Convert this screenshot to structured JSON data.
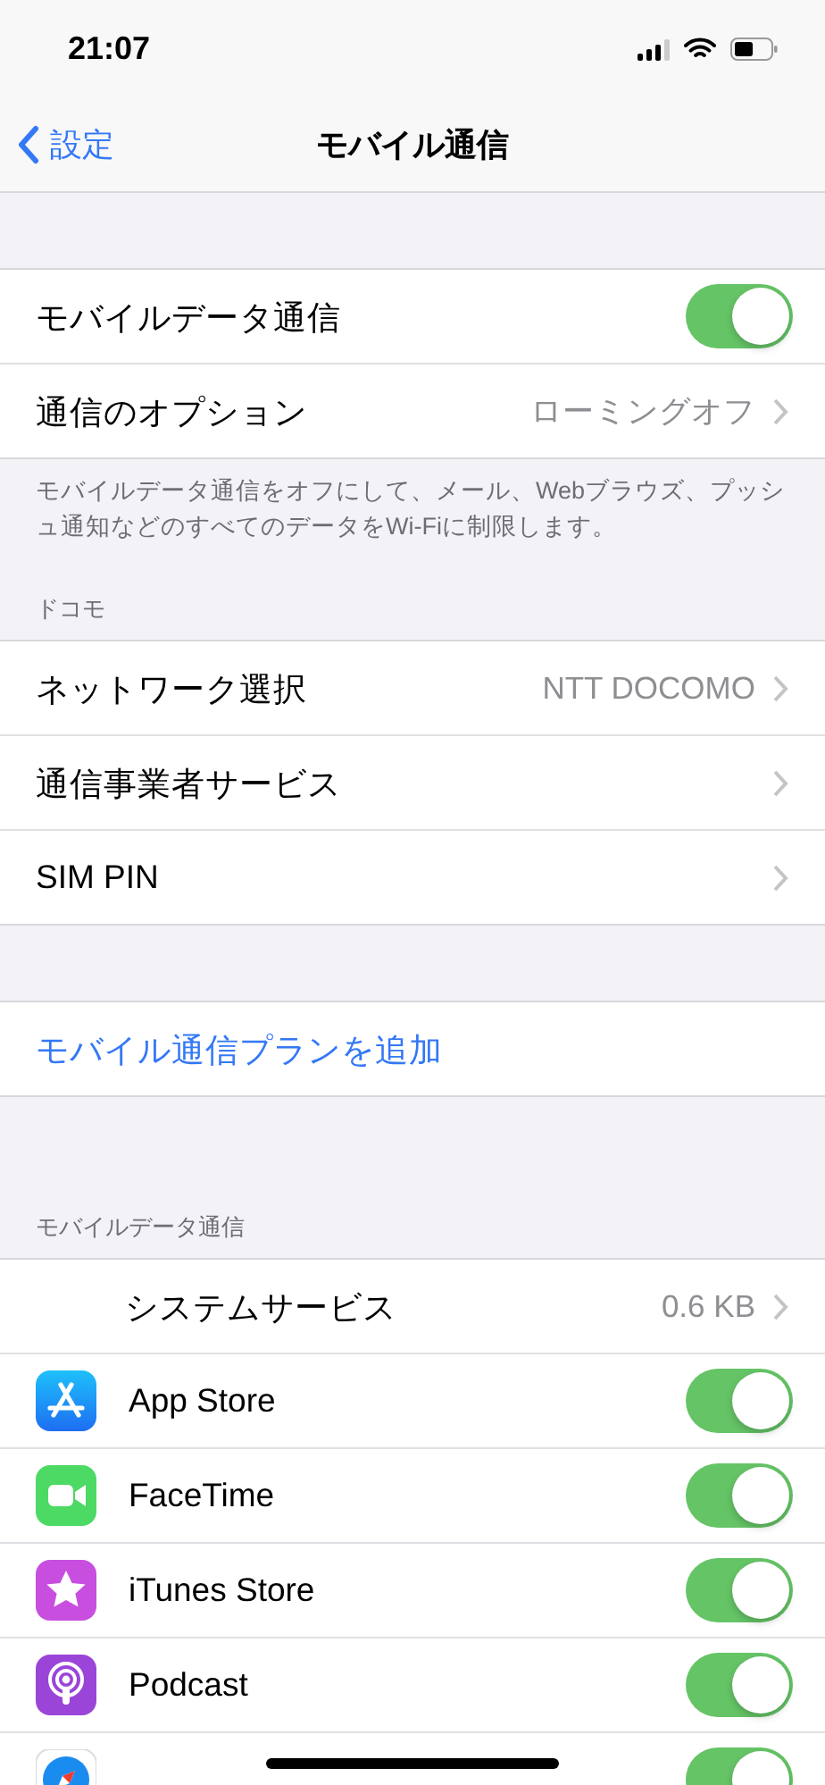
{
  "status_bar": {
    "time": "21:07"
  },
  "nav": {
    "back": "設定",
    "title": "モバイル通信"
  },
  "groups": [
    {
      "footer": "モバイルデータ通信をオフにして、メール、Webブラウズ、プッシュ通知などのすべてのデータをWi-Fiに制限します。",
      "rows": [
        {
          "kind": "toggle",
          "label": "モバイルデータ通信",
          "on": true
        },
        {
          "kind": "link",
          "label": "通信のオプション",
          "value": "ローミングオフ"
        }
      ]
    },
    {
      "header": "ドコモ",
      "rows": [
        {
          "kind": "link",
          "label": "ネットワーク選択",
          "value": "NTT DOCOMO"
        },
        {
          "kind": "link",
          "label": "通信事業者サービス"
        },
        {
          "kind": "link",
          "label": "SIM PIN"
        }
      ]
    },
    {
      "rows": [
        {
          "kind": "action",
          "label": "モバイル通信プランを追加"
        }
      ]
    },
    {
      "header": "モバイルデータ通信",
      "rows": [
        {
          "kind": "service",
          "label": "システムサービス",
          "value": "0.6 KB"
        },
        {
          "kind": "app",
          "label": "App Store",
          "on": true
        },
        {
          "kind": "app",
          "label": "FaceTime",
          "on": true
        },
        {
          "kind": "app",
          "label": "iTunes Store",
          "on": true
        },
        {
          "kind": "app",
          "label": "Podcast",
          "on": true
        },
        {
          "kind": "app",
          "on": true
        }
      ]
    }
  ]
}
